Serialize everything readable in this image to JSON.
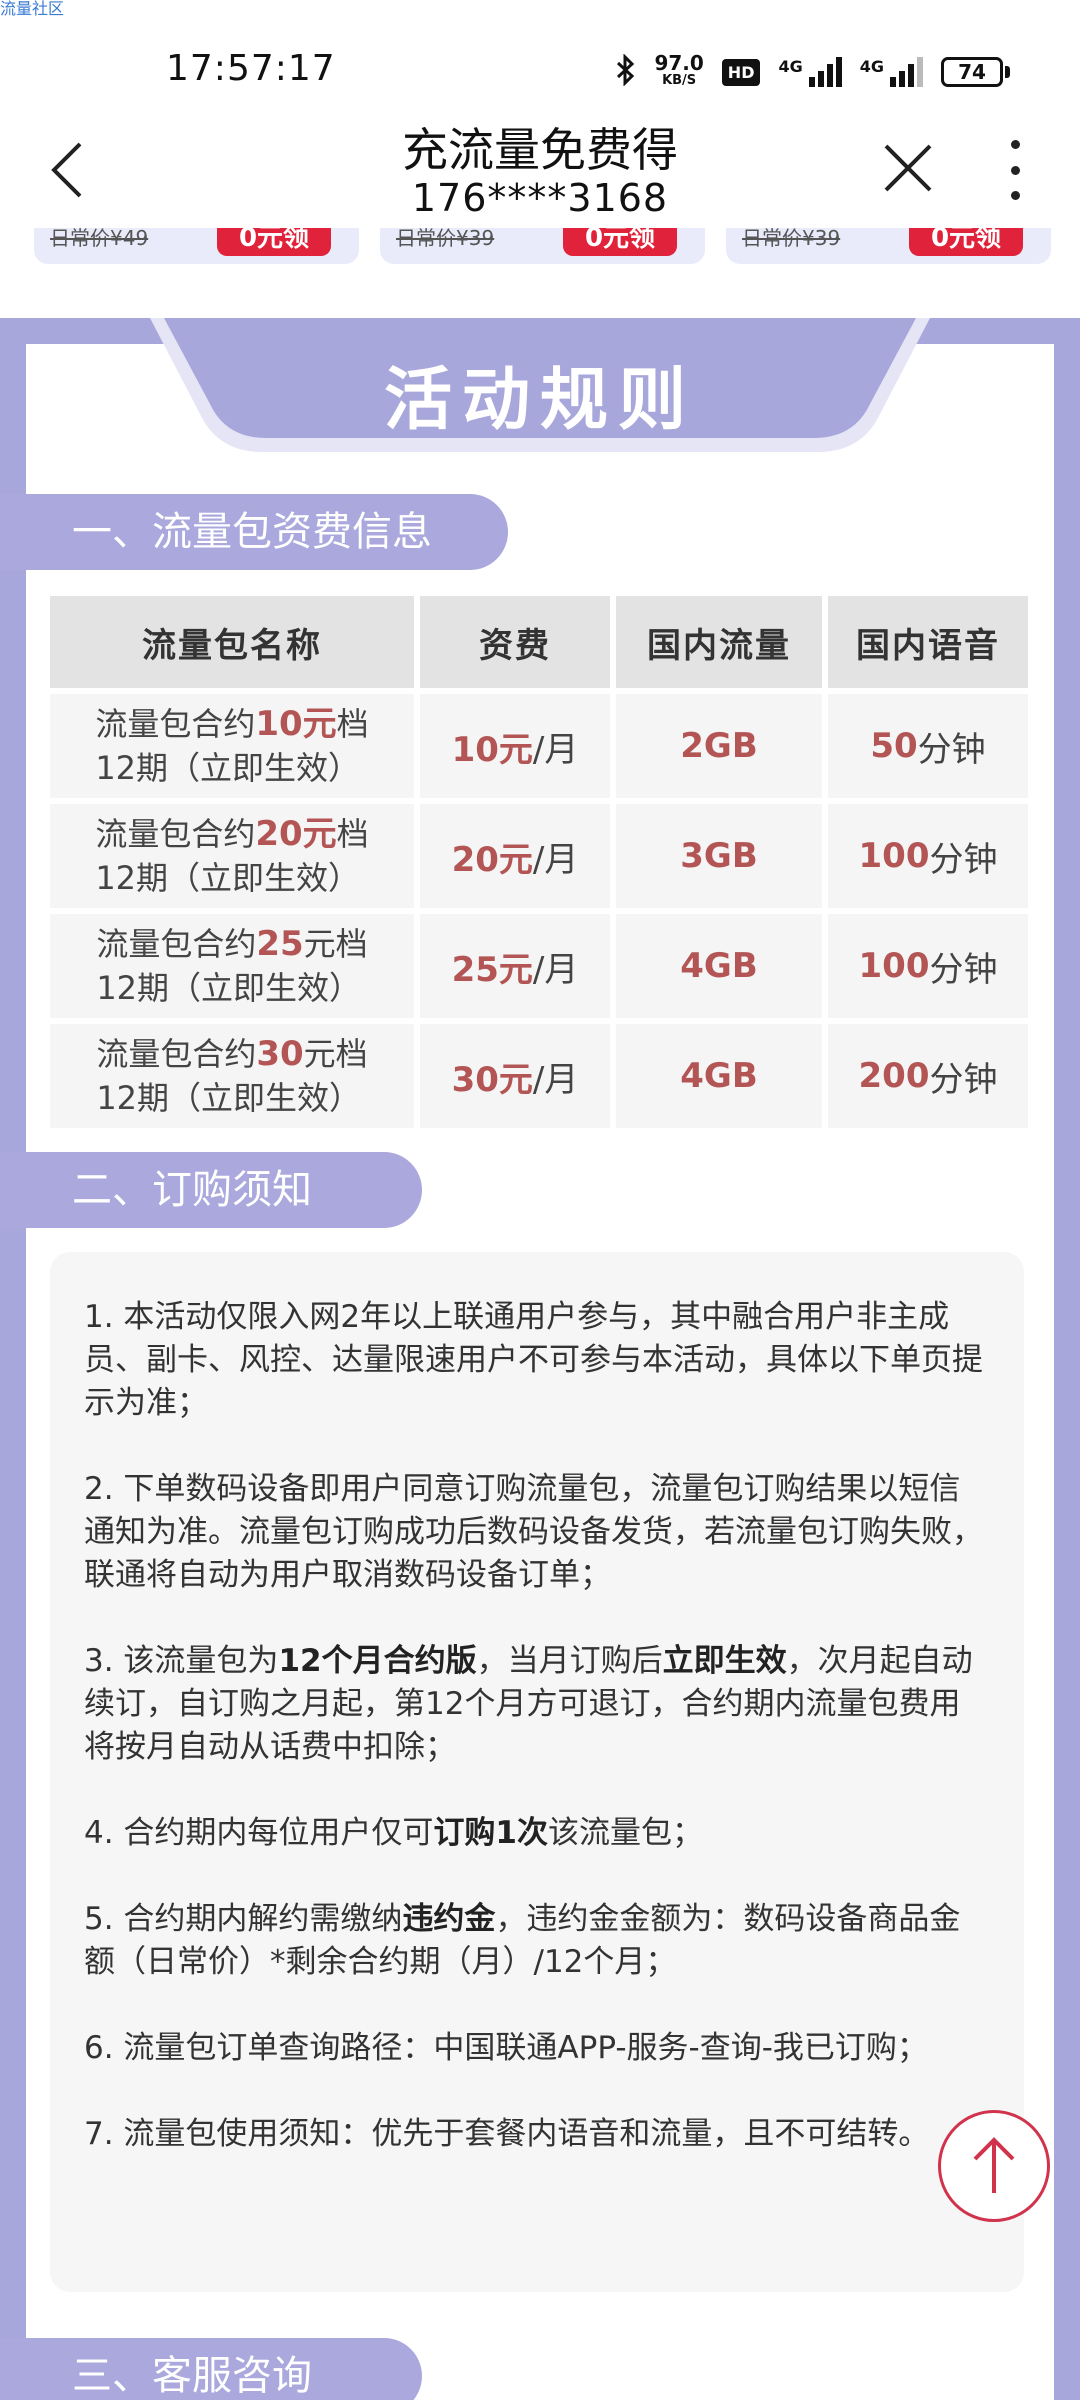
{
  "watermark": "流量社区",
  "status_bar": {
    "time": "17:57:17",
    "speed_value": "97.0",
    "speed_unit": "KB/S",
    "hd_label": "HD",
    "sim1_label": "4G",
    "sim2_label": "4G",
    "battery": "74"
  },
  "header": {
    "title": "充流量免费得",
    "subtitle": "176****3168"
  },
  "products": [
    {
      "old_price": "日常价¥49",
      "button": "0元领"
    },
    {
      "old_price": "日常价¥39",
      "button": "0元领"
    },
    {
      "old_price": "日常价¥39",
      "button": "0元领"
    }
  ],
  "rules": {
    "tab_title": "活动规则",
    "section1_title": "一、流量包资费信息",
    "table": {
      "headers": [
        "流量包名称",
        "资费",
        "国内流量",
        "国内语音"
      ],
      "rows": [
        {
          "name_pre": "流量包合约",
          "name_amt": "10元",
          "name_post": "档",
          "name_line2": "12期（立即生效）",
          "fee_amt": "10元",
          "fee_unit": "/月",
          "data": "2GB",
          "voice_amt": "50",
          "voice_unit": "分钟"
        },
        {
          "name_pre": "流量包合约",
          "name_amt": "20元",
          "name_post": "档",
          "name_line2": "12期（立即生效）",
          "fee_amt": "20元",
          "fee_unit": "/月",
          "data": "3GB",
          "voice_amt": "100",
          "voice_unit": "分钟"
        },
        {
          "name_pre": "流量包合约",
          "name_amt": "25",
          "name_post": "元档",
          "name_line2": "12期（立即生效）",
          "fee_amt": "25元",
          "fee_unit": "/月",
          "data": "4GB",
          "voice_amt": "100",
          "voice_unit": "分钟"
        },
        {
          "name_pre": "流量包合约",
          "name_amt": "30",
          "name_post": "元档",
          "name_line2": "12期（立即生效）",
          "fee_amt": "30元",
          "fee_unit": "/月",
          "data": "4GB",
          "voice_amt": "200",
          "voice_unit": "分钟"
        }
      ]
    },
    "section2_title": "二、订购须知",
    "notes": {
      "n1": "1. 本活动仅限入网2年以上联通用户参与，其中融合用户非主成员、副卡、风控、达量限速用户不可参与本活动，具体以下单页提示为准；",
      "n2": "2. 下单数码设备即用户同意订购流量包，流量包订购结果以短信通知为准。流量包订购成功后数码设备发货，若流量包订购失败，联通将自动为用户取消数码设备订单；",
      "n3_a": "3. 该流量包为",
      "n3_b": "12个月合约版",
      "n3_c": "，当月订购后",
      "n3_d": "立即生效",
      "n3_e": "，次月起自动续订，自订购之月起，第12个月方可退订，合约期内流量包费用将按月自动从话费中扣除；",
      "n4_a": "4. 合约期内每位用户仅可",
      "n4_b": "订购1次",
      "n4_c": "该流量包；",
      "n5_a": "5. 合约期内解约需缴纳",
      "n5_b": "违约金",
      "n5_c": "，违约金金额为：数码设备商品金额（日常价）*剩余合约期（月）/12个月；",
      "n6": "6. 流量包订单查询路径：中国联通APP-服务-查询-我已订购；",
      "n7": "7. 流量包使用须知：优先于套餐内语音和流量，且不可结转。"
    },
    "section3_title": "三、客服咨询"
  }
}
